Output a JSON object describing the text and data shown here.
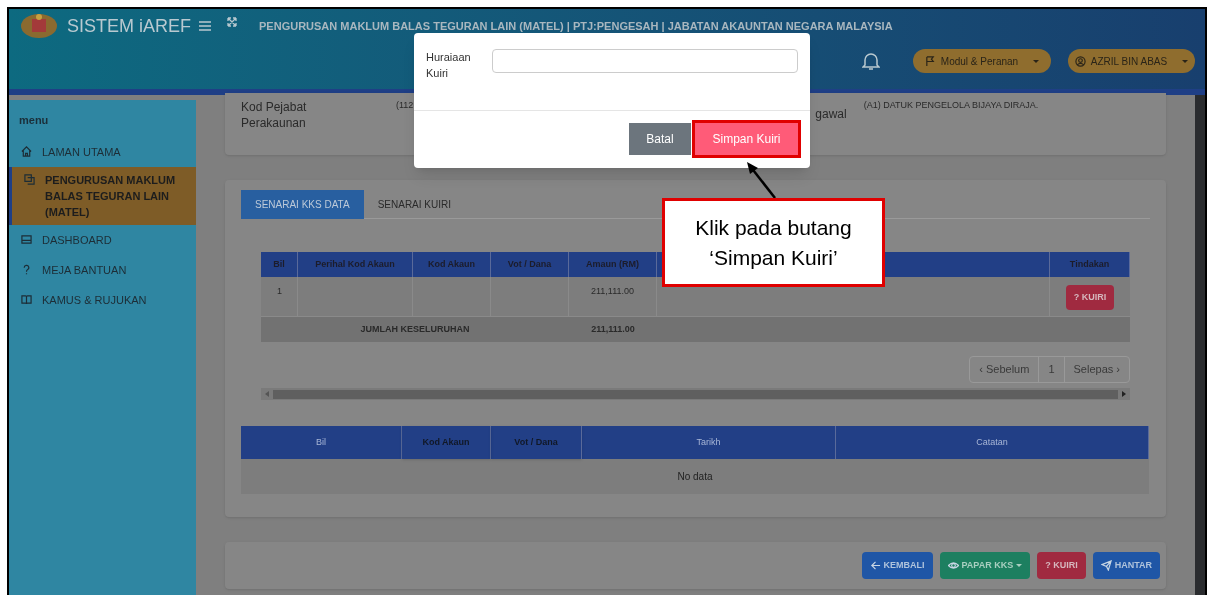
{
  "header": {
    "app_name": "SISTEM iAREF",
    "page_title": "PENGURUSAN MAKLUM BALAS TEGURAN LAIN (MATEL) | PTJ:PENGESAH | JABATAN AKAUNTAN NEGARA MALAYSIA",
    "menu_buttons": [
      {
        "label": "Modul & Peranan",
        "kind": "module"
      },
      {
        "label": "AZRIL BIN ABAS",
        "kind": "user"
      }
    ]
  },
  "sidebar": {
    "heading": "menu",
    "items": [
      {
        "label": "LAMAN UTAMA",
        "kind": "home",
        "selected": false
      },
      {
        "label": "PENGURUSAN MAKLUM BALAS TEGURAN LAIN (MATEL)",
        "kind": "pages",
        "selected": true
      },
      {
        "label": "DASHBOARD",
        "kind": "dashboard",
        "selected": false
      },
      {
        "label": "MEJA BANTUAN",
        "kind": "help",
        "selected": false
      },
      {
        "label": "KAMUS & RUJUKAN",
        "kind": "book",
        "selected": false
      }
    ]
  },
  "info": {
    "label_1": "Kod Pejabat Perakaunan",
    "value_1": "(112",
    "label_2": "gawal",
    "value_2": "(A1) DATUK PENGELOLA BIJAYA DIRAJA."
  },
  "tabs": [
    {
      "label": "SENARAI KKS DATA",
      "selected": true
    },
    {
      "label": "SENARAI KUIRI",
      "selected": false
    }
  ],
  "kks_table": {
    "columns": [
      "Bil",
      "Perihal Kod Akaun",
      "Kod Akaun",
      "Vot / Dana",
      "Amaun (RM)",
      "Tindakan"
    ],
    "rows": [
      {
        "bil": "1",
        "amaun": "211,111.00",
        "action": "? KUIRI"
      }
    ],
    "total": {
      "label": "JUMLAH KESELURUHAN",
      "amaun": "211,111.00"
    }
  },
  "pagination": [
    "‹ Sebelum",
    "1",
    "Selepas ›"
  ],
  "kuiri_table": {
    "columns": [
      "Bil",
      "Kod Akaun",
      "Vot / Dana",
      "Tarikh",
      "Catatan"
    ],
    "empty_text": "No data"
  },
  "footer_buttons": [
    {
      "label": "KEMBALI",
      "kind": "back"
    },
    {
      "label": "PAPAR KKS",
      "kind": "view"
    },
    {
      "label": "? KUIRI",
      "kind": "query"
    },
    {
      "label": "HANTAR",
      "kind": "send"
    }
  ],
  "modal": {
    "label": "Huraiaan Kuiri",
    "buttons": [
      {
        "label": "Batal",
        "kind": "cancel"
      },
      {
        "label": "Simpan Kuiri",
        "kind": "save",
        "highlighted": true
      }
    ]
  },
  "callout": {
    "lines": [
      "Klik pada butang",
      "‘Simpan Kuiri’"
    ]
  }
}
